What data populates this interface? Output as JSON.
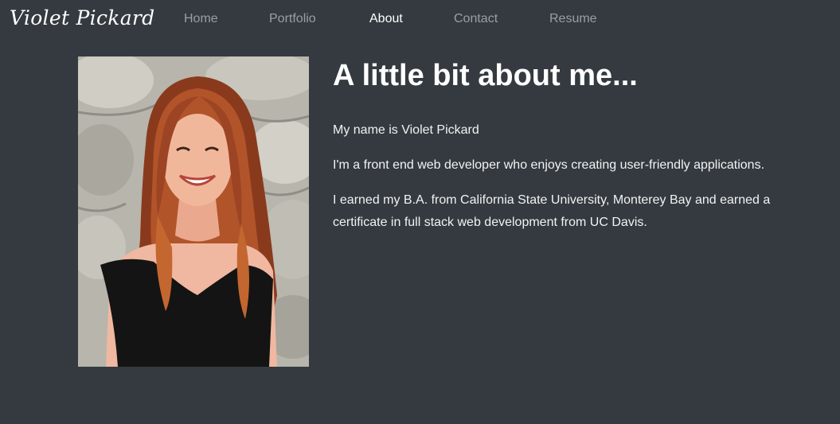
{
  "nav": {
    "brand": "Violet Pickard",
    "links": [
      {
        "label": "Home",
        "active": false
      },
      {
        "label": "Portfolio",
        "active": false
      },
      {
        "label": "About",
        "active": true
      },
      {
        "label": "Contact",
        "active": false
      },
      {
        "label": "Resume",
        "active": false
      }
    ]
  },
  "about": {
    "heading": "A little bit about me...",
    "paragraphs": [
      "My name is Violet Pickard",
      "I'm a front end web developer who enjoys creating user-friendly applications.",
      "I earned my B.A. from California State University, Monterey Bay and earned a certificate in full stack web development from UC Davis."
    ]
  },
  "colors": {
    "background": "#343a40",
    "nav_link": "#9b9ea2",
    "nav_link_active": "#ffffff",
    "text": "#ffffff"
  }
}
